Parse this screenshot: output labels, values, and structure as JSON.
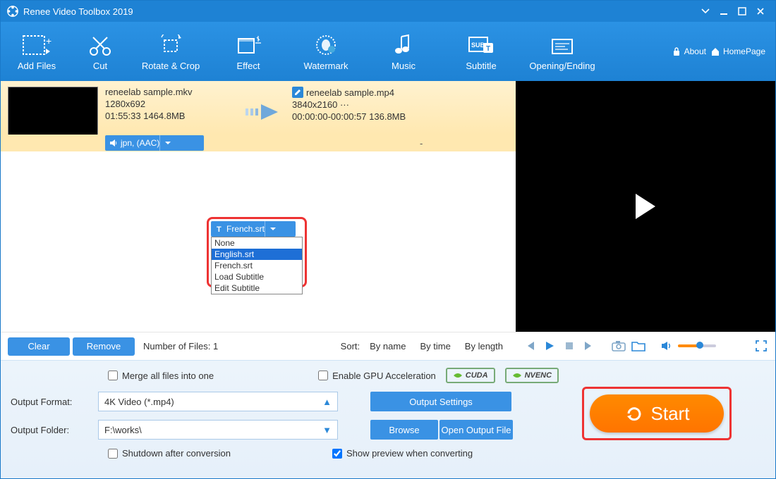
{
  "app": {
    "title": "Renee Video Toolbox 2019"
  },
  "toolbar": {
    "add_files": "Add Files",
    "cut": "Cut",
    "rotate_crop": "Rotate & Crop",
    "effect": "Effect",
    "watermark": "Watermark",
    "music": "Music",
    "subtitle": "Subtitle",
    "opening": "Opening/Ending",
    "about": "About",
    "homepage": "HomePage"
  },
  "file": {
    "src_name": "reneelab sample.mkv",
    "src_res": "1280x692",
    "src_info": "01:55:33 1464.8MB",
    "audio_chip": "jpn,       (AAC)",
    "sub_chip": "French.srt",
    "out_name": "reneelab sample.mp4",
    "out_res": "3840x2160  ···",
    "out_info": "00:00:00-00:00:57 136.8MB",
    "dash": "-"
  },
  "sub_options": {
    "o0": "None",
    "o1": "English.srt",
    "o2": "French.srt",
    "o3": "Load Subtitle",
    "o4": "Edit Subtitle"
  },
  "listctrl": {
    "clear": "Clear",
    "remove": "Remove",
    "nfiles": "Number of Files:  1",
    "sort_label": "Sort: ",
    "by_name": "By name",
    "by_time": "By time",
    "by_length": "By length"
  },
  "bottom": {
    "merge": "Merge all files into one",
    "gpu": "Enable GPU Acceleration",
    "cuda": "CUDA",
    "nvenc": "NVENC",
    "fmt_label": "Output Format:",
    "fmt_value": "4K Video (*.mp4)",
    "out_settings": "Output Settings",
    "folder_label": "Output Folder:",
    "folder_value": "F:\\works\\",
    "browse": "Browse",
    "open_folder": "Open Output File",
    "shutdown": "Shutdown after conversion",
    "show_preview": "Show preview when converting",
    "start": "Start"
  }
}
